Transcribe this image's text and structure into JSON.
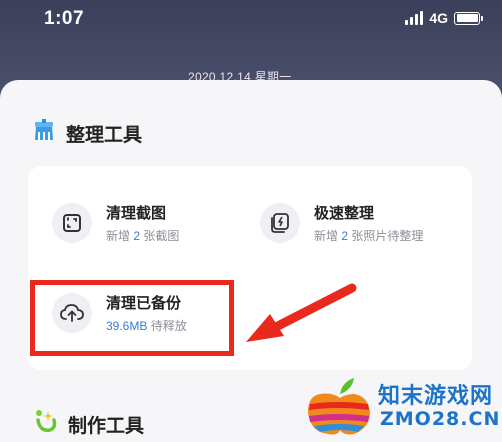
{
  "status_bar": {
    "time": "1:07",
    "network": "4G"
  },
  "lock_date": "2020.12.14 星期一",
  "sections": {
    "organize_tools": {
      "title": "整理工具",
      "icon": "broom-icon",
      "items": [
        {
          "name": "清理截图",
          "sub_prefix": "新增 ",
          "sub_highlight": "2",
          "sub_suffix": " 张截图",
          "icon": "screenshot-icon"
        },
        {
          "name": "极速整理",
          "sub_prefix": "新增 ",
          "sub_highlight": "2",
          "sub_suffix": " 张照片待整理",
          "icon": "lightning-photos-icon"
        },
        {
          "name": "清理已备份",
          "sub_prefix": "",
          "sub_highlight": "39.6MB",
          "sub_suffix": " 待释放",
          "icon": "cloud-upload-icon"
        }
      ]
    },
    "make_tools": {
      "title": "制作工具",
      "icon": "sparkle-icon"
    }
  },
  "watermark": {
    "name_cn": "知末游戏网",
    "domain": "ZMO28.CN"
  },
  "colors": {
    "accent_blue": "#3a7bd5",
    "highlight_red": "#e8291b",
    "card_bg": "#ffffff",
    "sheet_bg": "#f6f6f8"
  }
}
